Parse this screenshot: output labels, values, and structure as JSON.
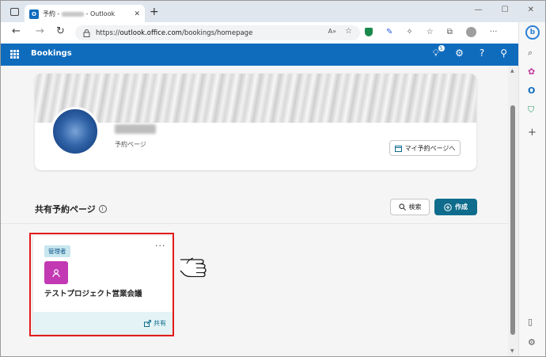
{
  "browser": {
    "tab_title_prefix": "予約 - ",
    "tab_title_suffix": " - Outlook",
    "url_scheme": "https://",
    "url_host": "outlook.office.com",
    "url_path": "/bookings/homepage",
    "new_tab_label": "+",
    "minimize_label": "—",
    "maximize_label": "☐",
    "close_label": "✕"
  },
  "app": {
    "title": "Bookings",
    "notification_count": "5"
  },
  "profile": {
    "subtitle": "予約ページ",
    "my_page_button": "マイ予約ページへ"
  },
  "shared": {
    "section_title": "共有予約ページ",
    "search_button": "検索",
    "create_button": "作成"
  },
  "calendar_card": {
    "role": "管理者",
    "name": "テストプロジェクト営業会議",
    "share_label": "共有",
    "more_label": "···"
  },
  "colors": {
    "header_blue": "#0f6cbd",
    "create_teal": "#0f6c8c",
    "card_icon": "#c239b3",
    "highlight": "#e21a1a"
  }
}
